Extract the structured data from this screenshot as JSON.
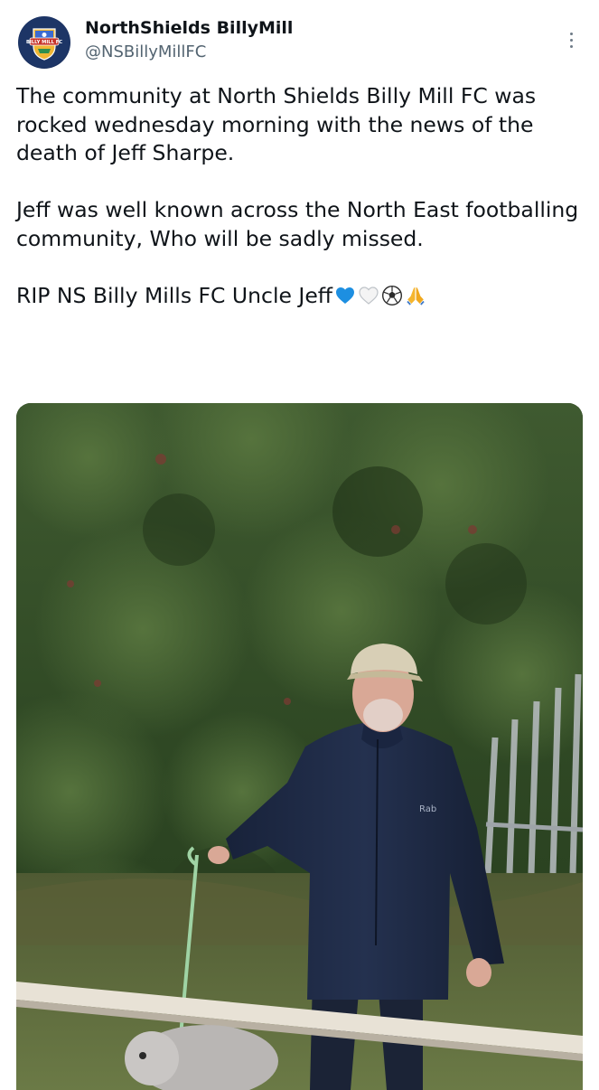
{
  "tweet": {
    "author": {
      "display_name": "NorthShields BillyMill",
      "handle": "@NSBillyMillFC",
      "avatar_text": "BILLY MILL FC"
    },
    "more_icon": "three-dots-vertical-icon",
    "paragraphs": [
      "The community at North Shields Billy Mill FC was rocked wednesday morning with the news of the death of Jeff Sharpe.",
      "Jeff was well known across the North East footballing community, Who will be sadly missed.",
      "RIP NS Billy Mills FC Uncle Jeff"
    ],
    "emojis": [
      "blue-heart-icon",
      "white-heart-icon",
      "soccer-ball-icon",
      "folded-hands-icon"
    ],
    "photo": {
      "icon": "photo-man-with-dog-icon",
      "jacket_brand": "Rab"
    }
  },
  "colors": {
    "text": "#0f1419",
    "secondary_text": "#536471",
    "avatar_bg": "#1d3566",
    "blue_heart": "#1d8fe1"
  }
}
